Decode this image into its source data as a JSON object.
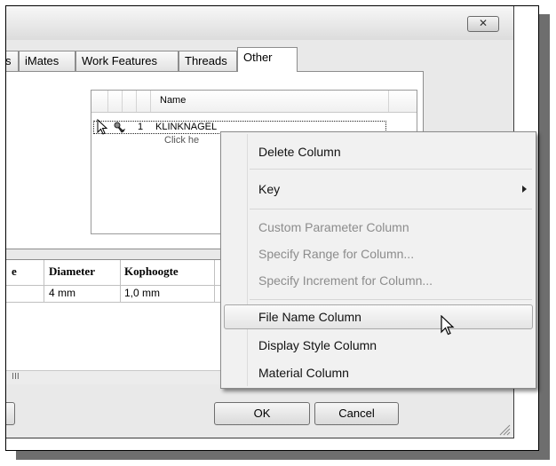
{
  "dialog": {
    "close_label": "✕",
    "tabs": [
      {
        "label": "s"
      },
      {
        "label": "iMates"
      },
      {
        "label": "Work Features"
      },
      {
        "label": "Threads"
      },
      {
        "label": "Other"
      }
    ],
    "grid": {
      "column_header": "Name",
      "row_number": "1",
      "row_value": "KLINKNAGEL",
      "add_row_hint": "Click he"
    },
    "table": {
      "headers": [
        "e",
        "Diameter",
        "Kophoogte"
      ],
      "row": [
        "",
        "4 mm",
        "1,0 mm"
      ]
    },
    "scroll_marker": "III",
    "ok_label": "OK",
    "cancel_label": "Cancel"
  },
  "context_menu": {
    "items": [
      {
        "label": "Delete Column",
        "enabled": true
      },
      {
        "label": "Key",
        "enabled": true,
        "submenu": true
      },
      {
        "label": "Custom Parameter Column",
        "enabled": false
      },
      {
        "label": "Specify Range for Column...",
        "enabled": false
      },
      {
        "label": "Specify Increment for Column...",
        "enabled": false
      },
      {
        "label": "File Name Column",
        "enabled": true,
        "highlighted": true
      },
      {
        "label": "Display Style Column",
        "enabled": true
      },
      {
        "label": "Material Column",
        "enabled": true
      }
    ]
  },
  "icons": {
    "close": "close-icon",
    "grid_cursor": "arrow-cursor-icon",
    "key": "key-icon",
    "submenu": "submenu-arrow-icon",
    "mouse": "mouse-pointer-icon"
  }
}
